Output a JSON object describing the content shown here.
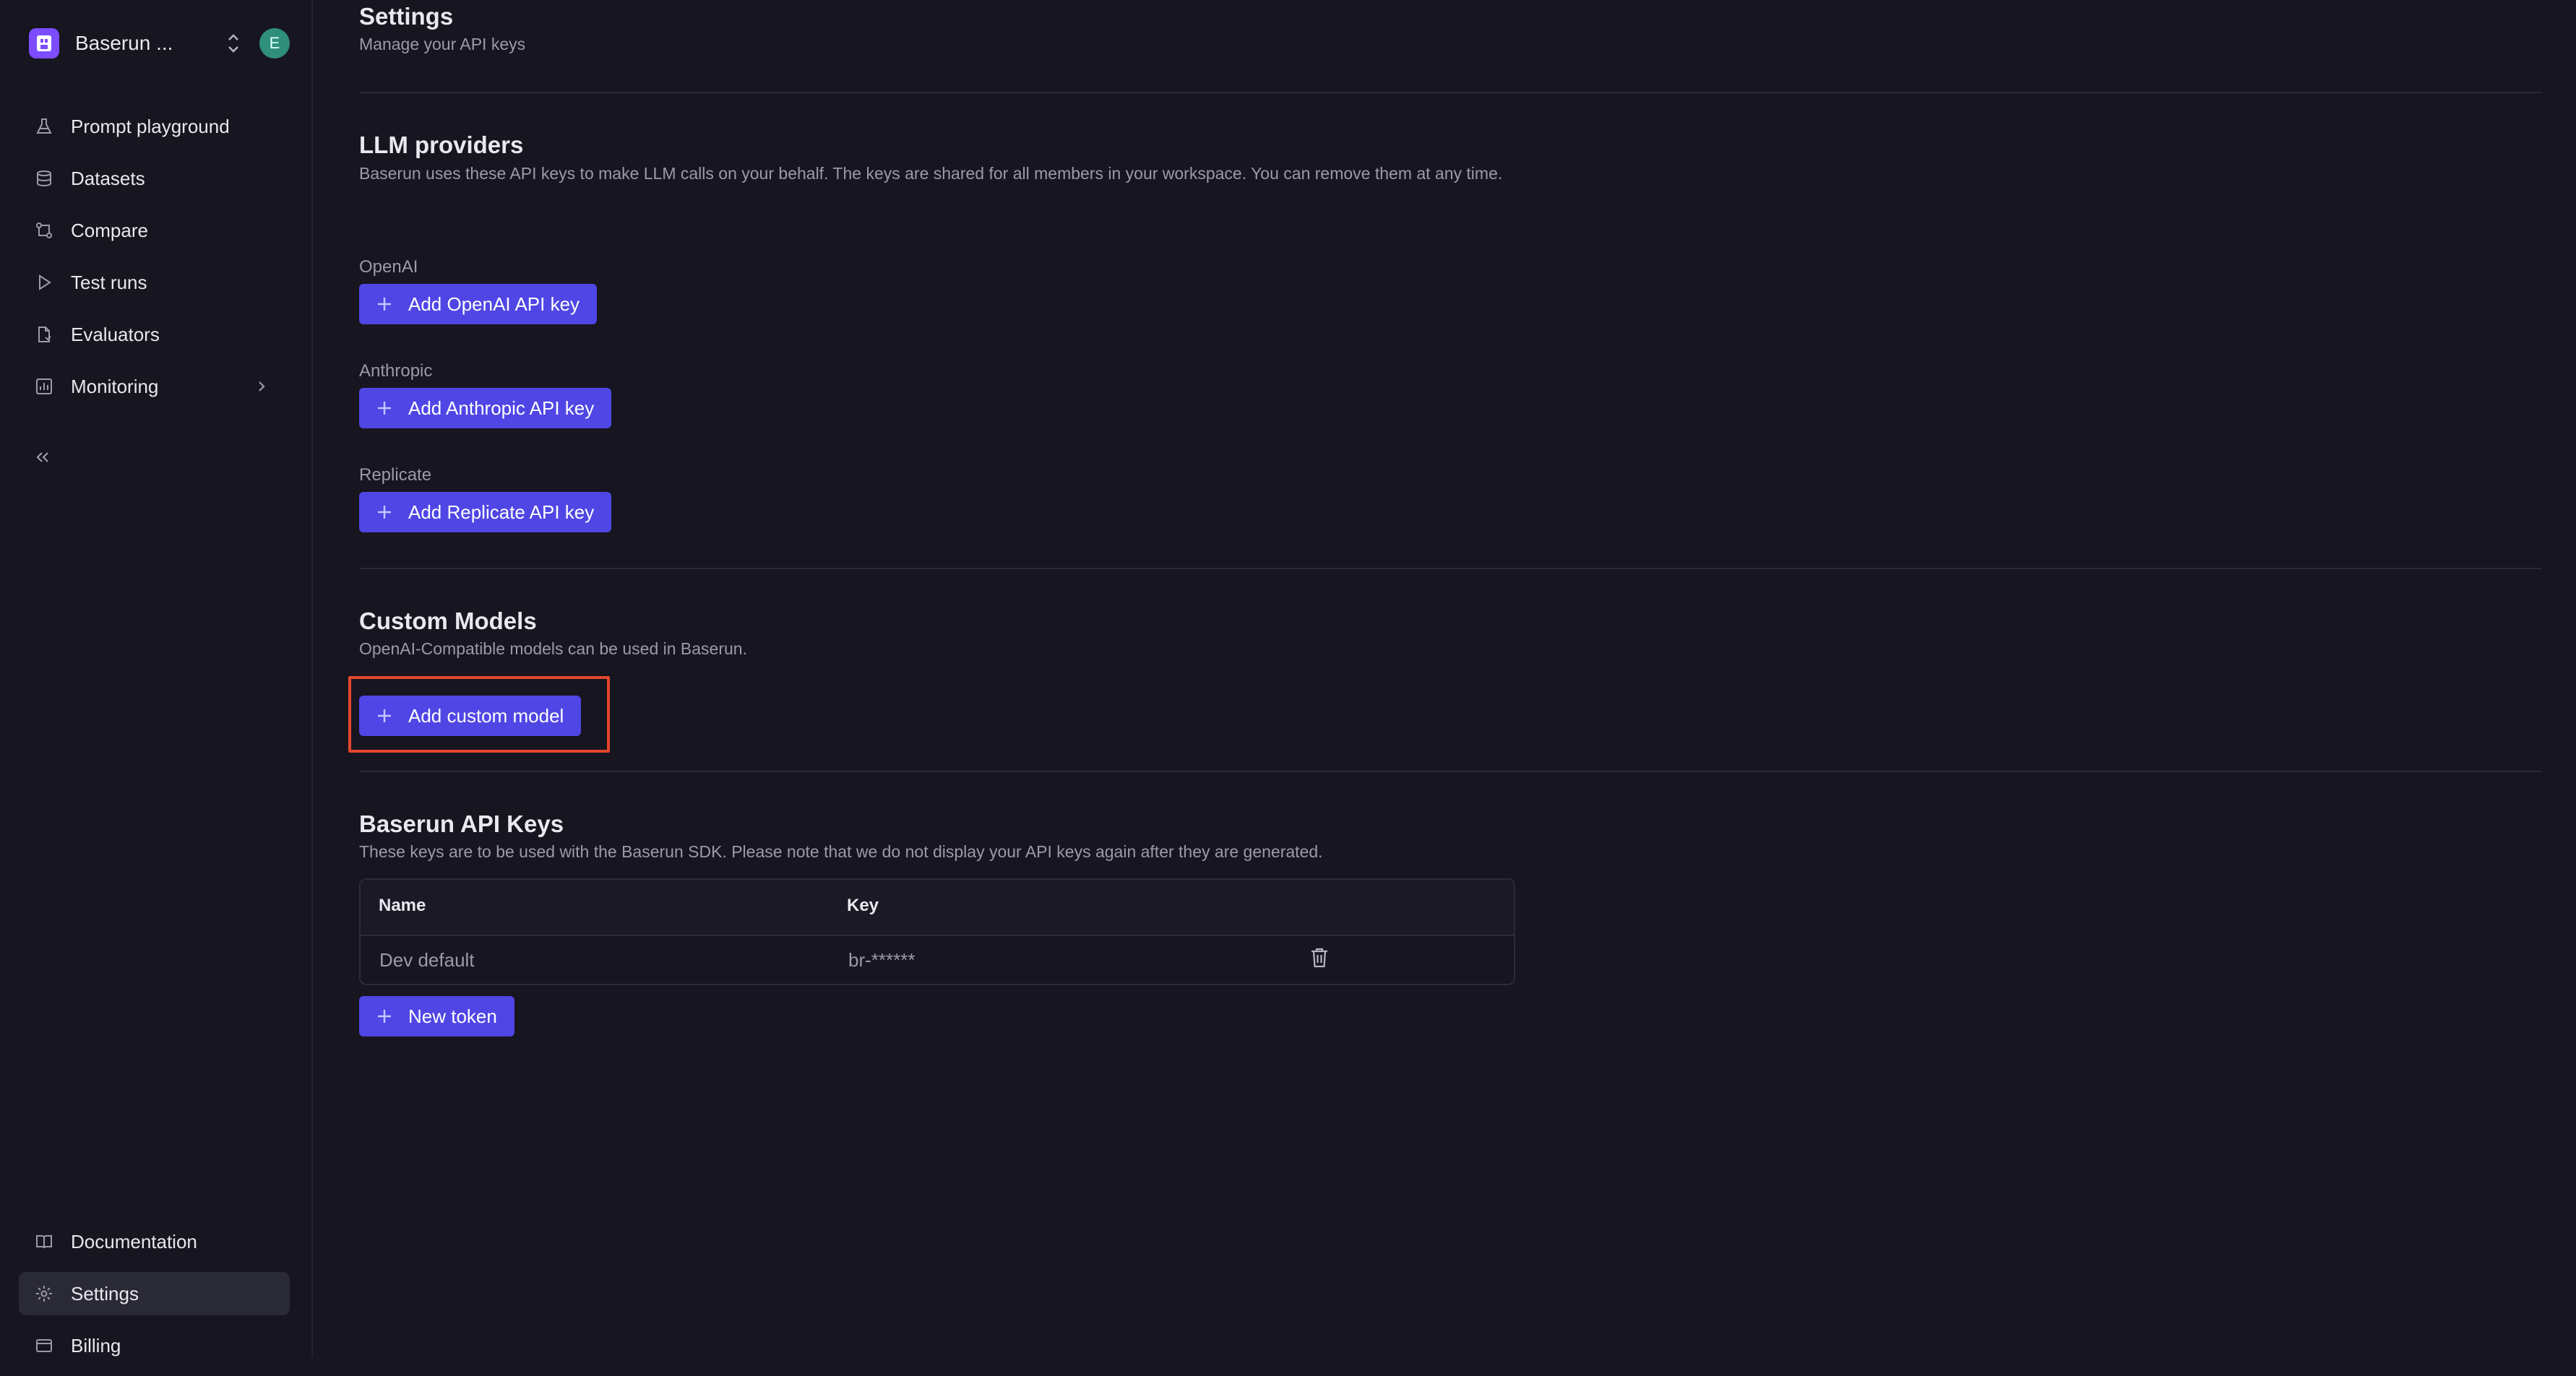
{
  "workspace": {
    "name": "Baserun ...",
    "avatar_letter": "E"
  },
  "sidebar": {
    "items": [
      {
        "label": "Prompt playground",
        "icon": "flask-icon"
      },
      {
        "label": "Datasets",
        "icon": "database-icon"
      },
      {
        "label": "Compare",
        "icon": "git-compare-icon"
      },
      {
        "label": "Test runs",
        "icon": "play-icon"
      },
      {
        "label": "Evaluators",
        "icon": "file-check-icon"
      },
      {
        "label": "Monitoring",
        "icon": "chart-icon"
      }
    ],
    "bottom_items": [
      {
        "label": "Documentation",
        "icon": "book-icon"
      },
      {
        "label": "Settings",
        "icon": "gear-icon",
        "active": true
      },
      {
        "label": "Billing",
        "icon": "billing-icon"
      }
    ]
  },
  "header": {
    "title": "Settings",
    "subtitle": "Manage your API keys"
  },
  "llm": {
    "title": "LLM providers",
    "description": "Baserun uses these API keys to make LLM calls on your behalf. The keys are shared for all members in your workspace. You can remove them at any time.",
    "providers": [
      {
        "label": "OpenAI",
        "button": "Add OpenAI API key"
      },
      {
        "label": "Anthropic",
        "button": "Add Anthropic API key"
      },
      {
        "label": "Replicate",
        "button": "Add Replicate API key"
      }
    ]
  },
  "custom": {
    "title": "Custom Models",
    "description": "OpenAI-Compatible models can be used in Baserun.",
    "button": "Add custom model"
  },
  "keys": {
    "title": "Baserun API Keys",
    "description": "These keys are to be used with the Baserun SDK. Please note that we do not display your API keys again after they are generated.",
    "columns": [
      "Name",
      "Key"
    ],
    "rows": [
      {
        "name": "Dev default",
        "key": "br-******"
      }
    ],
    "new_button": "New token"
  },
  "colors": {
    "accent": "#4f46e5",
    "highlight": "#e4462c",
    "background": "#161520"
  }
}
